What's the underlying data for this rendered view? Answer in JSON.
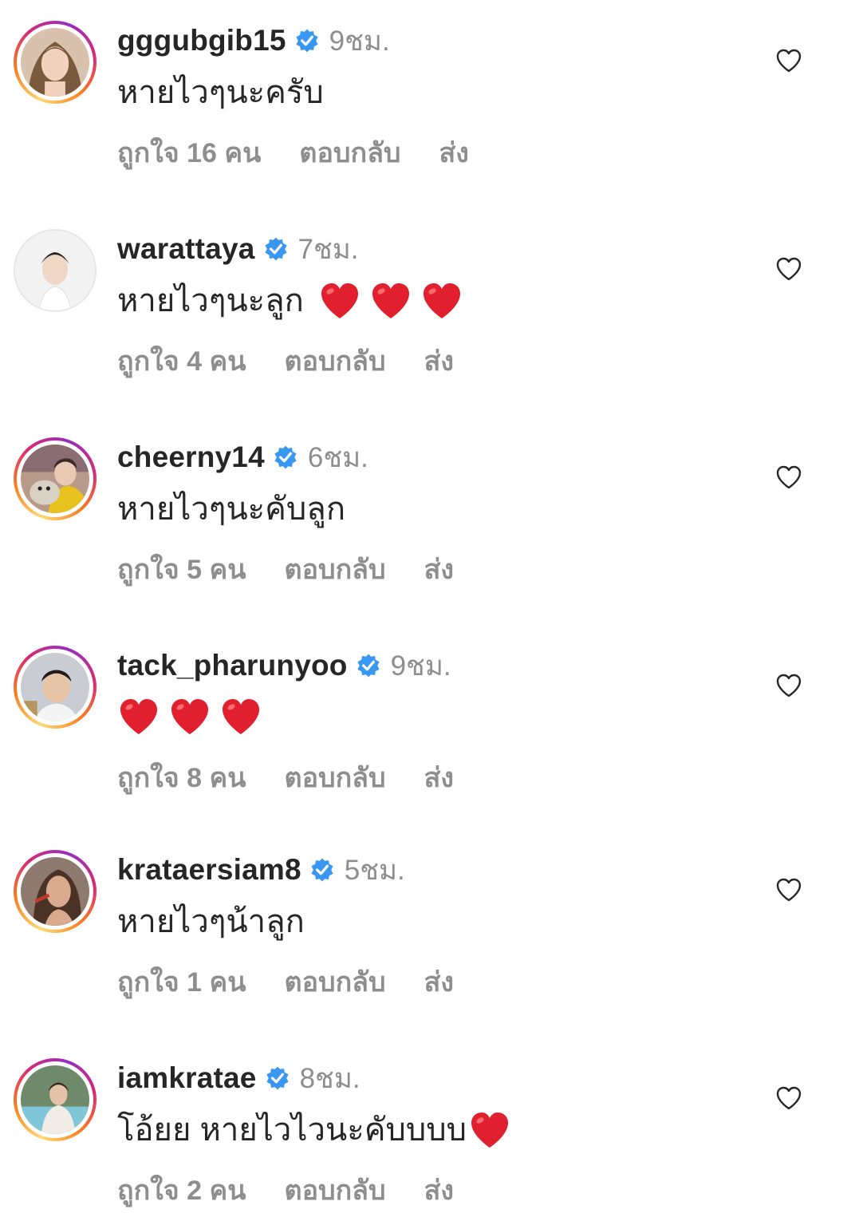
{
  "comments": [
    {
      "username": "gggubgib15",
      "time": "9ชม.",
      "text": "หายไวๆนะครับ",
      "hearts": 0,
      "likes_label": "ถูกใจ 16 คน",
      "reply_label": "ตอบกลับ",
      "send_label": "ส่ง",
      "avatar_ring": "story"
    },
    {
      "username": "warattaya",
      "time": "7ชม.",
      "text": "หายไวๆนะลูก",
      "hearts": 3,
      "likes_label": "ถูกใจ 4 คน",
      "reply_label": "ตอบกลับ",
      "send_label": "ส่ง",
      "avatar_ring": "none"
    },
    {
      "username": "cheerny14",
      "time": "6ชม.",
      "text": "หายไวๆนะคับลูก",
      "hearts": 0,
      "likes_label": "ถูกใจ 5 คน",
      "reply_label": "ตอบกลับ",
      "send_label": "ส่ง",
      "avatar_ring": "story"
    },
    {
      "username": "tack_pharunyoo",
      "time": "9ชม.",
      "text": "",
      "hearts": 3,
      "likes_label": "ถูกใจ 8 คน",
      "reply_label": "ตอบกลับ",
      "send_label": "ส่ง",
      "avatar_ring": "story"
    },
    {
      "username": "krataersiam8",
      "time": "5ชม.",
      "text": "หายไวๆน้าลูก",
      "hearts": 0,
      "likes_label": "ถูกใจ 1 คน",
      "reply_label": "ตอบกลับ",
      "send_label": "ส่ง",
      "avatar_ring": "story"
    },
    {
      "username": "iamkratae",
      "time": "8ชม.",
      "text": "โอ้ยย หายไวไวนะคับบบบ",
      "hearts": 1,
      "likes_label": "ถูกใจ 2 คน",
      "reply_label": "ตอบกลับ",
      "send_label": "ส่ง",
      "avatar_ring": "story"
    }
  ],
  "colors": {
    "text": "#262626",
    "secondary": "#8e8e8e",
    "verified": "#3897f0",
    "heart_emoji": "#e0202e"
  },
  "icons": {
    "verified": "verified-badge-icon",
    "like": "heart-outline-icon",
    "emoji": "red-heart-emoji"
  }
}
